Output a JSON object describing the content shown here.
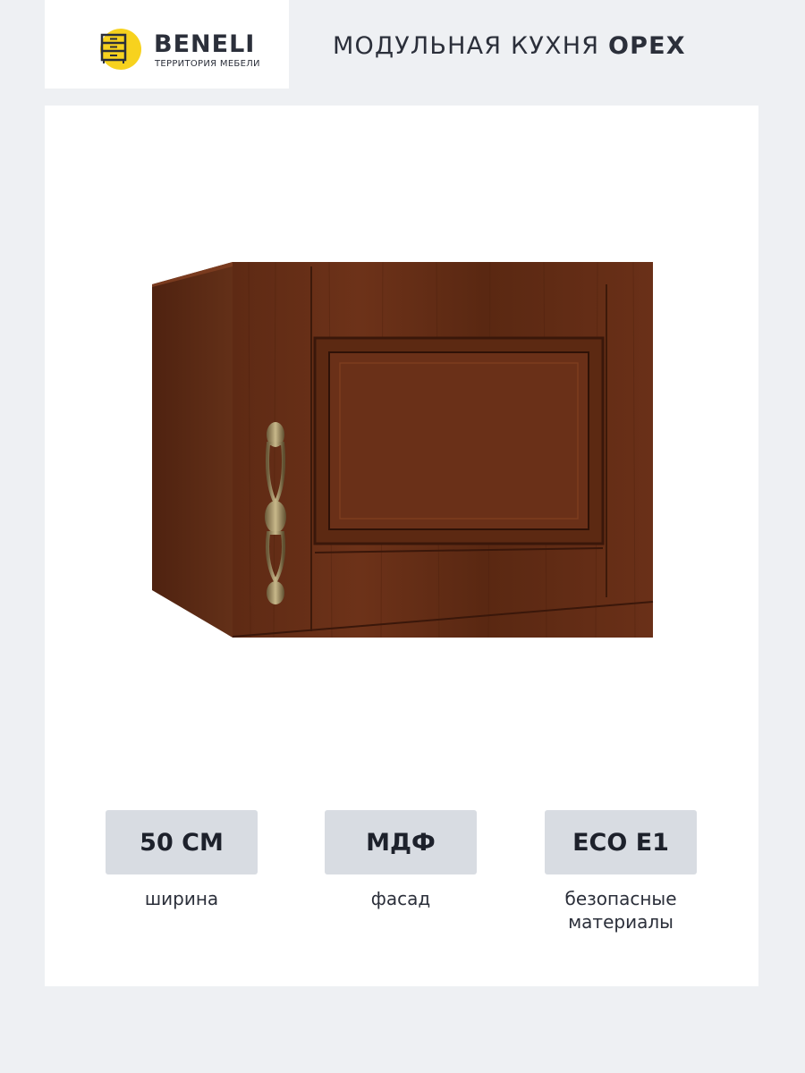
{
  "brand": {
    "name": "BENELI",
    "tagline": "ТЕРРИТОРИЯ МЕБЕЛИ",
    "accent_color": "#f7d21e"
  },
  "title": {
    "prefix": "МОДУЛЬНАЯ КУХНЯ",
    "highlight": "ОРЕХ"
  },
  "product": {
    "icon": "kitchen-wall-cabinet-image"
  },
  "specs": [
    {
      "value": "50 СМ",
      "label": "ширина"
    },
    {
      "value": "МДФ",
      "label": "фасад"
    },
    {
      "value": "ECO E1",
      "label": "безопасные материалы"
    }
  ]
}
